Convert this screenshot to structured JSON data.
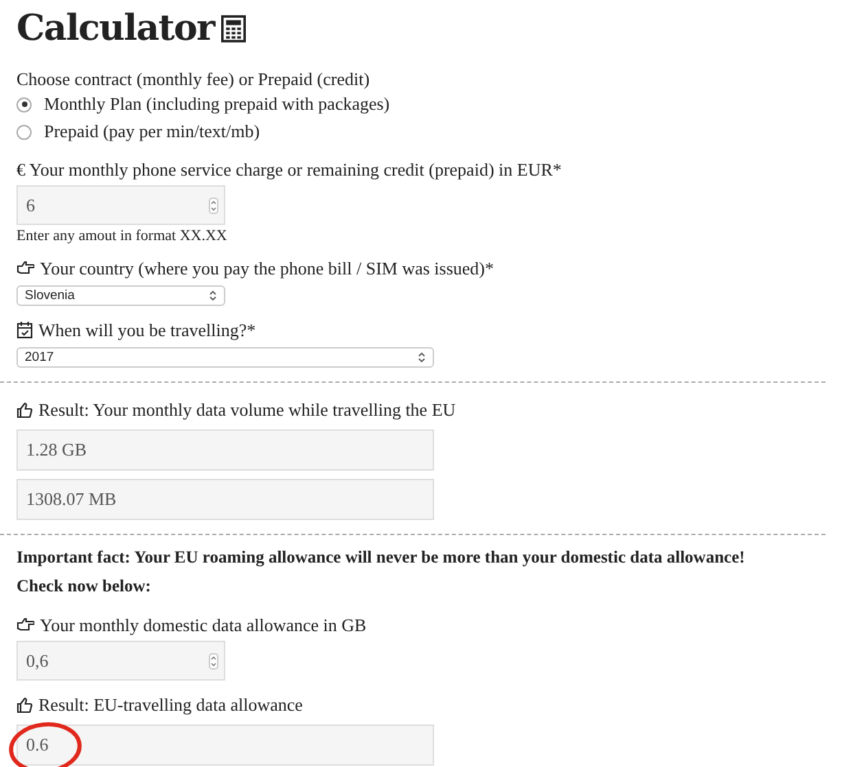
{
  "title": "Calculator",
  "contract": {
    "label": "Choose contract (monthly fee) or Prepaid (credit)",
    "options": [
      {
        "label": "Monthly Plan (including prepaid with packages)",
        "selected": true
      },
      {
        "label": "Prepaid (pay per min/text/mb)",
        "selected": false
      }
    ]
  },
  "charge": {
    "label": "€ Your monthly phone service charge or remaining credit (prepaid) in EUR*",
    "value": "6",
    "hint": "Enter any amout in format XX.XX"
  },
  "country": {
    "label": "Your country (where you pay the phone bill / SIM was issued)*",
    "value": "Slovenia"
  },
  "travel": {
    "label": "When will you be travelling?*",
    "value": "2017"
  },
  "result": {
    "label": "Result: Your monthly data volume while travelling the EU",
    "values": [
      "1.28 GB",
      "1308.07 MB"
    ]
  },
  "notice": [
    "Important fact: Your EU roaming allowance will never be more than your domestic data allowance!",
    "Check now below:"
  ],
  "domestic": {
    "label": "Your monthly domestic data allowance in GB",
    "value": "0,6"
  },
  "allowance": {
    "label": "Result: EU-travelling data allowance",
    "value": "0.6",
    "circled": true
  }
}
